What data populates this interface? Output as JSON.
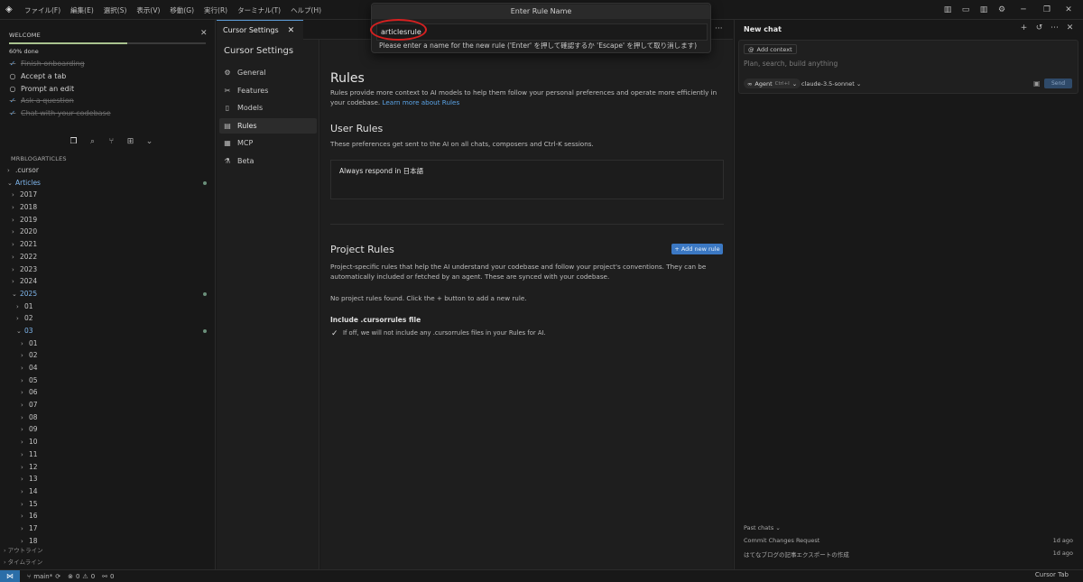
{
  "menu": [
    "ファイル(F)",
    "編集(E)",
    "選択(S)",
    "表示(V)",
    "移動(G)",
    "実行(R)",
    "ターミナル(T)",
    "ヘルプ(H)"
  ],
  "palette": {
    "title": "Enter Rule Name",
    "value": "articlesrule",
    "hint": "Please enter a name for the new rule ('Enter' を押して確認するか 'Escape' を押して取り消します)"
  },
  "welcome": {
    "title": "WELCOME",
    "progress_text": "60% done",
    "progress_fraction": 0.6,
    "items": [
      {
        "label": "Finish onboarding",
        "done": true
      },
      {
        "label": "Accept a tab",
        "done": false
      },
      {
        "label": "Prompt an edit",
        "done": false
      },
      {
        "label": "Ask a question",
        "done": true
      },
      {
        "label": "Chat with your codebase",
        "done": true
      }
    ]
  },
  "explorer": {
    "title": "MRBLOGARTICLES",
    "tree": [
      {
        "label": ".cursor",
        "depth": 0,
        "open": false
      },
      {
        "label": "Articles",
        "depth": 0,
        "open": true,
        "blue": true,
        "dot": true
      },
      {
        "label": "2017",
        "depth": 1,
        "open": false
      },
      {
        "label": "2018",
        "depth": 1,
        "open": false
      },
      {
        "label": "2019",
        "depth": 1,
        "open": false
      },
      {
        "label": "2020",
        "depth": 1,
        "open": false
      },
      {
        "label": "2021",
        "depth": 1,
        "open": false
      },
      {
        "label": "2022",
        "depth": 1,
        "open": false
      },
      {
        "label": "2023",
        "depth": 1,
        "open": false
      },
      {
        "label": "2024",
        "depth": 1,
        "open": false
      },
      {
        "label": "2025",
        "depth": 1,
        "open": true,
        "blue": true,
        "dot": true
      },
      {
        "label": "01",
        "depth": 2,
        "open": false
      },
      {
        "label": "02",
        "depth": 2,
        "open": false
      },
      {
        "label": "03",
        "depth": 2,
        "open": true,
        "blue": true,
        "dot": true
      },
      {
        "label": "01",
        "depth": 3,
        "open": false
      },
      {
        "label": "02",
        "depth": 3,
        "open": false
      },
      {
        "label": "04",
        "depth": 3,
        "open": false
      },
      {
        "label": "05",
        "depth": 3,
        "open": false
      },
      {
        "label": "06",
        "depth": 3,
        "open": false
      },
      {
        "label": "07",
        "depth": 3,
        "open": false
      },
      {
        "label": "08",
        "depth": 3,
        "open": false
      },
      {
        "label": "09",
        "depth": 3,
        "open": false
      },
      {
        "label": "10",
        "depth": 3,
        "open": false
      },
      {
        "label": "11",
        "depth": 3,
        "open": false
      },
      {
        "label": "12",
        "depth": 3,
        "open": false
      },
      {
        "label": "13",
        "depth": 3,
        "open": false
      },
      {
        "label": "14",
        "depth": 3,
        "open": false
      },
      {
        "label": "15",
        "depth": 3,
        "open": false
      },
      {
        "label": "16",
        "depth": 3,
        "open": false
      },
      {
        "label": "17",
        "depth": 3,
        "open": false
      },
      {
        "label": "18",
        "depth": 3,
        "open": false
      }
    ],
    "sections": [
      "アウトライン",
      "タイムライン"
    ]
  },
  "editor": {
    "tab_label": "Cursor Settings"
  },
  "settings": {
    "title": "Cursor Settings",
    "nav": [
      {
        "label": "General",
        "icon": "gear-icon",
        "glyph": "⚙",
        "active": false
      },
      {
        "label": "Features",
        "icon": "tools-icon",
        "glyph": "✂",
        "active": false
      },
      {
        "label": "Models",
        "icon": "document-icon",
        "glyph": "▯",
        "active": false
      },
      {
        "label": "Rules",
        "icon": "rules-icon",
        "glyph": "▤",
        "active": true
      },
      {
        "label": "MCP",
        "icon": "server-icon",
        "glyph": "▦",
        "active": false
      },
      {
        "label": "Beta",
        "icon": "flask-icon",
        "glyph": "⚗",
        "active": false
      }
    ],
    "rules": {
      "heading": "Rules",
      "desc": "Rules provide more context to AI models to help them follow your personal preferences and operate more efficiently in your codebase.",
      "learn_more": "Learn more about Rules",
      "user_heading": "User Rules",
      "user_desc": "These preferences get sent to the AI on all chats, composers and Ctrl-K sessions.",
      "user_rule_text": "Always respond in 日本語",
      "project_heading": "Project Rules",
      "add_rule": "Add new rule",
      "project_desc": "Project-specific rules that help the AI understand your codebase and follow your project's conventions. They can be automatically included or fetched by an agent. These are synced with your codebase.",
      "no_rules": "No project rules found. Click the + button to add a new rule.",
      "include_heading": "Include .cursorrules file",
      "include_desc": "If off, we will not include any .cursorrules files in your Rules for AI."
    }
  },
  "chat": {
    "title": "New chat",
    "add_context": "Add context",
    "placeholder": "Plan, search, build anything",
    "agent_label": "Agent",
    "agent_shortcut": "Ctrl+I",
    "model": "claude-3.5-sonnet",
    "send": "Send",
    "past_title": "Past chats",
    "past": [
      {
        "title": "Commit Changes Request",
        "time": "1d ago"
      },
      {
        "title": "はてなブログの記事エクスポートの作成",
        "time": "1d ago"
      }
    ]
  },
  "status": {
    "branch": "main*",
    "errors": "0",
    "warnings": "0",
    "ports": "0",
    "right": "Cursor Tab"
  }
}
